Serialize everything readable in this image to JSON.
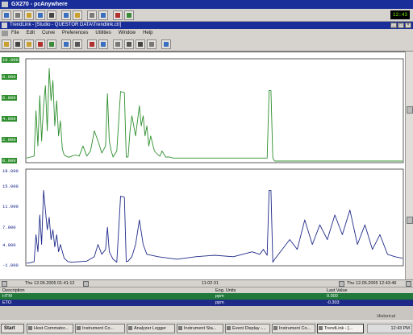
{
  "outer_window": {
    "title": "GX270 - pcAnywhere",
    "clock": "12:43"
  },
  "inner_window": {
    "title": "TrendLink - [Studio - QUESTOR DATA\\Trendlink.ctr]"
  },
  "menu": [
    "File",
    "Edit",
    "Curve",
    "Preferences",
    "Utilities",
    "Window",
    "Help"
  ],
  "chart": {
    "green_axis_labels": [
      "10.000",
      "8.000",
      "6.000",
      "4.000",
      "2.000",
      "0.000"
    ],
    "blue_axis_labels": [
      "18.000",
      "15.000",
      "11.000",
      "7.000",
      "4.000",
      "-1.000"
    ]
  },
  "timebar": {
    "start_time": "Thu 12.05.2005 01:41:12",
    "span": "11:02:31",
    "end_time": "Thu 12.05.2005 12:43:46"
  },
  "table": {
    "headers": {
      "description": "Description",
      "units": "Eng. Units",
      "value": "Last Value"
    },
    "rows": [
      {
        "description": "HTM",
        "units": "ppm",
        "value": "0.000",
        "color": "#20783a"
      },
      {
        "description": "ETO",
        "units": "ppm",
        "value": "-0.303",
        "color": "#1f2a88"
      }
    ]
  },
  "status": {
    "mode": "Historical"
  },
  "taskbar": {
    "start": "Start",
    "items": [
      "Host Commator...",
      "Instrument Co...",
      "Analyzer Logger",
      "Instrument Sta...",
      "Event Display -...",
      "Instrument Co...",
      "TrendLink - [..."
    ],
    "clock": "12:43 PM"
  },
  "chart_data": [
    {
      "type": "line",
      "series_color": "#2f8f2f",
      "ylim": [
        0,
        10
      ],
      "x": [
        0,
        0.01,
        0.02,
        0.025,
        0.03,
        0.035,
        0.04,
        0.045,
        0.05,
        0.055,
        0.06,
        0.065,
        0.07,
        0.075,
        0.08,
        0.085,
        0.09,
        0.095,
        0.1,
        0.105,
        0.11,
        0.115,
        0.12,
        0.13,
        0.14,
        0.15,
        0.16,
        0.17,
        0.18,
        0.19,
        0.2,
        0.21,
        0.215,
        0.22,
        0.225,
        0.23,
        0.24,
        0.25,
        0.26,
        0.265,
        0.27,
        0.275,
        0.28,
        0.29,
        0.3,
        0.305,
        0.31,
        0.315,
        0.32,
        0.325,
        0.33,
        0.34,
        0.35,
        0.355,
        0.36,
        0.37,
        0.38,
        0.39,
        0.4,
        0.45,
        0.5,
        0.55,
        0.6,
        0.63,
        0.64,
        0.645,
        0.65,
        0.655,
        0.66,
        0.68,
        0.7,
        0.75,
        0.8,
        0.85,
        0.9,
        0.95,
        1
      ],
      "values": [
        0.3,
        0.4,
        0.5,
        5,
        1.5,
        6.5,
        2,
        5.5,
        7.5,
        3,
        9.2,
        6,
        8,
        3.5,
        6,
        2.5,
        4,
        1.2,
        0.6,
        0.5,
        0.4,
        0.4,
        0.5,
        0.6,
        0.5,
        1.5,
        0.5,
        1,
        3,
        2,
        0.8,
        1.5,
        6.7,
        2,
        1,
        0.4,
        1,
        6.9,
        6.8,
        0.4,
        0.4,
        3,
        4.5,
        2.5,
        5.5,
        3.5,
        4.5,
        2.5,
        3.5,
        1.5,
        2.5,
        1,
        0.6,
        0.5,
        1,
        0.4,
        0.4,
        0.3,
        0.3,
        0.3,
        0.3,
        0.3,
        0.3,
        0.3,
        0.3,
        7,
        7,
        0.3,
        0,
        0,
        0,
        0,
        0,
        0,
        0,
        0,
        0
      ]
    },
    {
      "type": "line",
      "series_color": "#1f2a88",
      "ylim": [
        -1,
        18
      ],
      "x": [
        0,
        0.01,
        0.02,
        0.025,
        0.03,
        0.035,
        0.04,
        0.045,
        0.05,
        0.055,
        0.06,
        0.065,
        0.07,
        0.075,
        0.08,
        0.085,
        0.09,
        0.1,
        0.11,
        0.12,
        0.14,
        0.16,
        0.18,
        0.19,
        0.2,
        0.21,
        0.215,
        0.22,
        0.23,
        0.24,
        0.25,
        0.26,
        0.265,
        0.27,
        0.28,
        0.29,
        0.3,
        0.31,
        0.32,
        0.35,
        0.4,
        0.45,
        0.5,
        0.55,
        0.6,
        0.62,
        0.63,
        0.64,
        0.645,
        0.65,
        0.655,
        0.66,
        0.7,
        0.72,
        0.74,
        0.76,
        0.78,
        0.8,
        0.82,
        0.84,
        0.86,
        0.88,
        0.9,
        0.92,
        0.94,
        0.96,
        0.98,
        1
      ],
      "values": [
        -0.8,
        -0.7,
        -0.5,
        5,
        1.5,
        9,
        3,
        14,
        10,
        6,
        8.5,
        4,
        6,
        2.5,
        5,
        1.5,
        3,
        0.2,
        -0.5,
        -0.6,
        -0.5,
        -0.4,
        0.5,
        3,
        1,
        2,
        6.5,
        1.5,
        0,
        -0.6,
        12.8,
        12.6,
        -0.5,
        -0.4,
        0.5,
        3,
        8,
        3,
        1,
        0.5,
        0,
        0.5,
        0.8,
        0.5,
        1.5,
        1,
        2,
        0.8,
        14,
        14,
        -0.6,
        0,
        4,
        2,
        8,
        3,
        7,
        4,
        9,
        5,
        10,
        3,
        7,
        2,
        5,
        1,
        0.5,
        0.2
      ]
    }
  ]
}
